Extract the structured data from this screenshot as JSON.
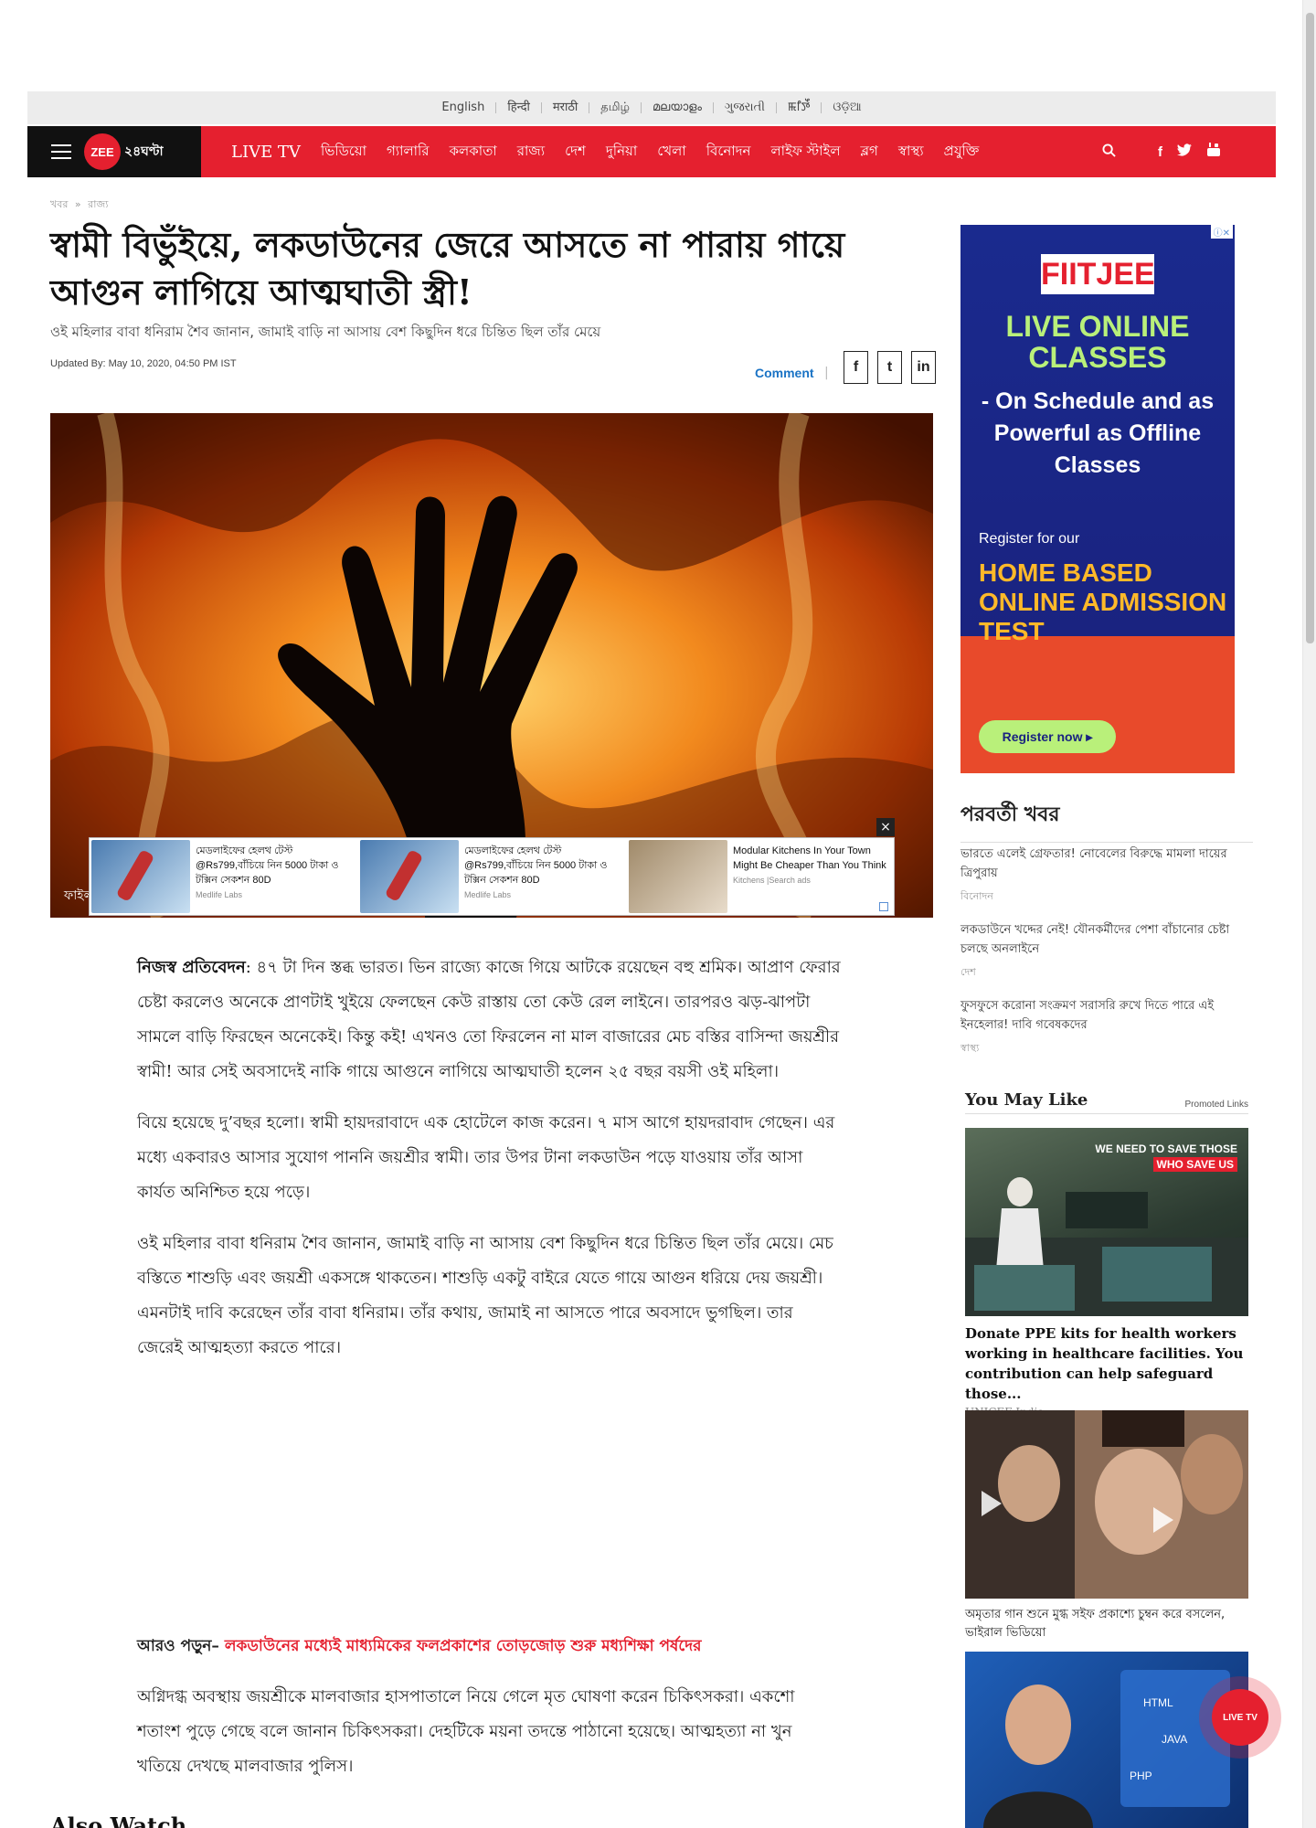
{
  "languages": [
    "English",
    "हिन्दी",
    "मराठी",
    "தமிழ்",
    "മലയാളം",
    "ગુજરાતી",
    "ꯃꯤꯇꯩ",
    "ଓଡ଼ିଆ"
  ],
  "logo": {
    "brand": "ZEE",
    "name": "২৪ঘণ্টা"
  },
  "nav": [
    "LIVE TV",
    "ভিডিয়ো",
    "গ্যালারি",
    "কলকাতা",
    "রাজ্য",
    "দেশ",
    "দুনিয়া",
    "খেলা",
    "বিনোদন",
    "লাইফ স্টাইল",
    "ব্লগ",
    "স্বাস্থ্য",
    "প্রযুক্তি"
  ],
  "breadcrumb": [
    "খবর",
    "»",
    "রাজ্য"
  ],
  "headline": "স্বামী বিভুঁইয়ে, লকডাউনের জেরে আসতে না পারায় গায়ে আগুন লাগিয়ে আত্মঘাতী স্ত্রী!",
  "subhead": "ওই মহিলার বাবা ধনিরাম শৈব জানান, জামাই বাড়ি না আসায় বেশ কিছুদিন ধরে চিন্তিত ছিল তাঁর মেয়ে",
  "updated": "Updated By: May 10, 2020, 04:50 PM IST",
  "comment": "Comment",
  "share_icons": [
    "f",
    "t",
    "in"
  ],
  "hero_caption": "ফাইল",
  "ad_strip": [
    {
      "text": "মেডলাইফের হেলথ টেস্ট @Rs799,বাঁচিয়ে নিন 5000 টাকা ও টক্সিন সেকশন 80D",
      "source": "Medlife Labs"
    },
    {
      "text": "মেডলাইফের হেলথ টেস্ট @Rs799,বাঁচিয়ে নিন 5000 টাকা ও টক্সিন সেকশন 80D",
      "source": "Medlife Labs"
    },
    {
      "text": "Modular Kitchens In Your Town Might Be Cheaper Than You Think",
      "source": "Kitchens |Search ads"
    }
  ],
  "ad_close": "×",
  "article": {
    "byline": "নিজস্ব প্রতিবেদন",
    "p1": ": ৪৭ টা দিন স্তব্ধ ভারত। ভিন রাজ্যে কাজে গিয়ে আটকে রয়েছেন বহু শ্রমিক। আপ্রাণ ফেরার চেষ্টা করলেও অনেকে প্রাণটাই খুইয়ে ফেলছেন কেউ রাস্তায় তো কেউ রেল লাইনে। তারপরও ঝড়-ঝাপটা সামলে বাড়ি ফিরছেন অনেকেই। কিন্তু কই! এখনও তো ফিরলেন না মাল বাজারের মেচ বস্তির বাসিন্দা জয়শ্রীর স্বামী! আর সেই অবসাদেই নাকি গায়ে আগুনে লাগিয়ে আত্মঘাতী হলেন ২৫ বছর বয়সী ওই মহিলা।",
    "p2": "বিয়ে হয়েছে দু’বছর হলো। স্বামী হায়দরাবাদে এক হোটেলে কাজ করেন। ৭ মাস আগে হায়দরাবাদ গেছেন। এর মধ্যে একবারও আসার সুযোগ পাননি জয়শ্রীর স্বামী। তার উপর টানা লকডাউন পড়ে যাওয়ায় তাঁর আসা কার্যত অনিশ্চিত হয়ে পড়ে।",
    "p3": "ওই মহিলার বাবা ধনিরাম শৈব জানান, জামাই বাড়ি না আসায় বেশ কিছুদিন ধরে চিন্তিত ছিল তাঁর মেয়ে। মেচ বস্তিতে শাশুড়ি এবং জয়শ্রী একসঙ্গে থাকতেন। শাশুড়ি একটু বাইরে যেতে গায়ে আগুন ধরিয়ে দেয় জয়শ্রী। এমনটাই দাবি করেছেন তাঁর বাবা ধনিরাম। তাঁর কথায়, জামাই না আসতে পারে অবসাদে ভুগছিল। তার জেরেই আত্মহত্যা করতে পারে।",
    "read_more_label": "আরও পড়ুন–",
    "read_more_link": "লকডাউনের মধ্যেই মাধ্যমিকের ফলপ্রকাশের তোড়জোড় শুরু মধ্যশিক্ষা পর্ষদের",
    "p4": "অগ্নিদগ্ধ অবস্থায় জয়শ্রীকে মালবাজার হাসপাতালে নিয়ে গেলে মৃত ঘোষণা করেন চিকিৎসকরা। একশো শতাংশ পুড়ে গেছে বলে জানান চিকিৎসকরা। দেহটিকে ময়না তদন্তে পাঠানো হয়েছে। আত্মহত্যা না খুন খতিয়ে দেখছে মালবাজার পুলিস।",
    "also_watch": "Also Watch"
  },
  "sidebar_ad": {
    "brand": "FIITJEE",
    "line1": "LIVE ONLINE CLASSES",
    "line2": "- On Schedule and as Powerful as Offline Classes",
    "line3": "Register for our",
    "line4": "HOME BASED ONLINE ADMISSION TEST",
    "cta": "Register now ▸"
  },
  "next_news": {
    "title": "পরবর্তী খবর",
    "items": [
      {
        "title": "ভারতে এলেই গ্রেফতার! নোবেলের বিরুদ্ধে মামলা দায়ের ত্রিপুরায়",
        "category": "বিনোদন"
      },
      {
        "title": "লকডাউনে খদ্দের নেই! যৌনকর্মীদের পেশা বাঁচানোর চেষ্টা চলছে অনলাইনে",
        "category": "দেশ"
      },
      {
        "title": "ফুসফুসে করোনা সংক্রমণ সরাসরি রুখে দিতে পারে এই ইনহেলার! দাবি গবেষকদের",
        "category": "স্বাস্থ্য"
      }
    ]
  },
  "you_may_like": {
    "title": "You May Like",
    "promoted": "Promoted Links",
    "items": [
      {
        "title": "Donate PPE kits for health workers working in healthcare facilities. You contribution can help safeguard those...",
        "source": "UNICEF India",
        "overlay1": "WE NEED TO SAVE THOSE",
        "overlay2": "WHO SAVE US"
      },
      {
        "title": "অমৃতার গান শুনে মুগ্ধ সইফ প্রকাশ্যে চুম্বন করে বসলেন, ভাইরাল ভিডিয়ো"
      }
    ]
  },
  "live_tv": "LIVE TV",
  "colors": {
    "brand_red": "#e5202f",
    "dark": "#111111",
    "link_blue": "#1a73c5"
  }
}
